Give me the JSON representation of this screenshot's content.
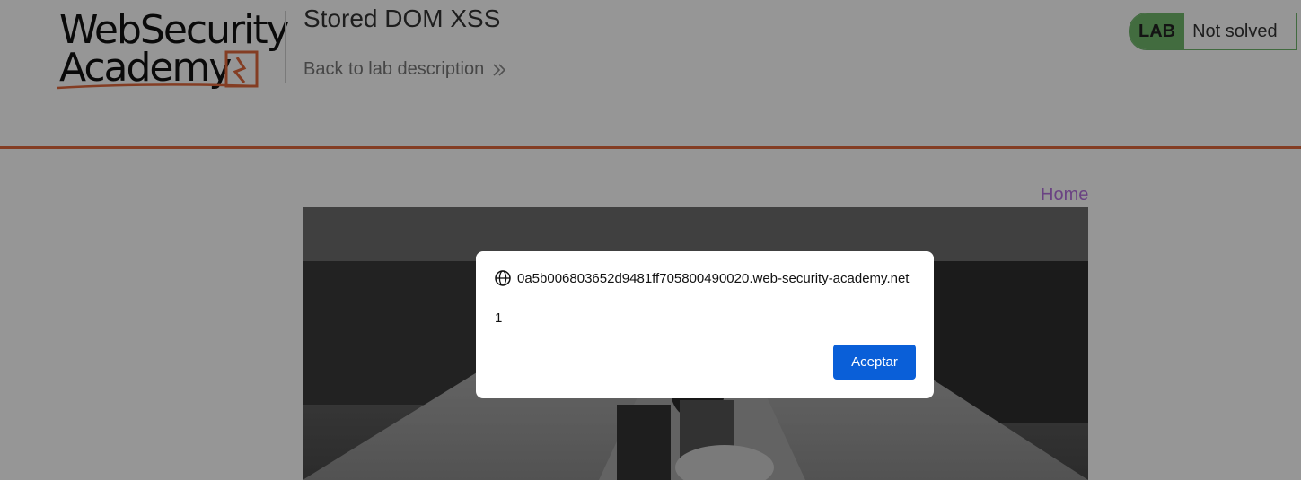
{
  "header": {
    "logo_line1": "WebSecurity",
    "logo_line2": "Academy",
    "lab_title": "Stored DOM XSS",
    "back_link": "Back to lab description",
    "lab_badge": "LAB",
    "lab_status": "Not solved"
  },
  "nav": {
    "home": "Home"
  },
  "dialog": {
    "origin": "0a5b006803652d9481ff705800490020.web-security-academy.net",
    "message": "1",
    "ok_label": "Aceptar"
  },
  "colors": {
    "accent_orange": "#e0693d",
    "lab_green": "#70b86b",
    "home_link_purple": "#b570df",
    "dialog_button_blue": "#0a5fd8"
  },
  "icons": {
    "logo_mark": "lightning-bolt-icon",
    "back_chevron": "double-chevron-right-icon",
    "dialog_origin": "globe-icon"
  }
}
